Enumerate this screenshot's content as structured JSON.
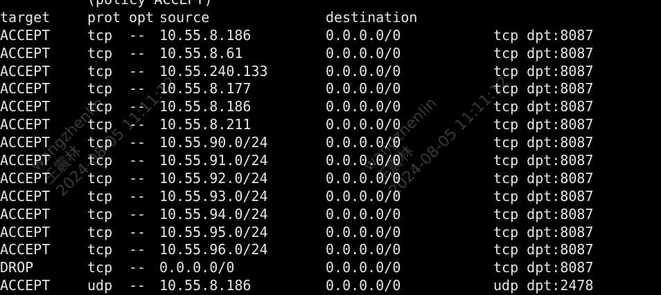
{
  "partial_top_text": "(policy ACCEPT)",
  "headers": {
    "target": "target",
    "prot": "prot",
    "opt": "opt",
    "source": "source",
    "destination": "destination"
  },
  "rows": [
    {
      "target": "ACCEPT",
      "prot": "tcp",
      "opt": "--",
      "source": "10.55.8.186",
      "destination": "0.0.0.0/0",
      "extra": "tcp dpt:8087"
    },
    {
      "target": "ACCEPT",
      "prot": "tcp",
      "opt": "--",
      "source": "10.55.8.61",
      "destination": "0.0.0.0/0",
      "extra": "tcp dpt:8087"
    },
    {
      "target": "ACCEPT",
      "prot": "tcp",
      "opt": "--",
      "source": "10.55.240.133",
      "destination": "0.0.0.0/0",
      "extra": "tcp dpt:8087"
    },
    {
      "target": "ACCEPT",
      "prot": "tcp",
      "opt": "--",
      "source": "10.55.8.177",
      "destination": "0.0.0.0/0",
      "extra": "tcp dpt:8087"
    },
    {
      "target": "ACCEPT",
      "prot": "tcp",
      "opt": "--",
      "source": "10.55.8.186",
      "destination": "0.0.0.0/0",
      "extra": "tcp dpt:8087"
    },
    {
      "target": "ACCEPT",
      "prot": "tcp",
      "opt": "--",
      "source": "10.55.8.211",
      "destination": "0.0.0.0/0",
      "extra": "tcp dpt:8087"
    },
    {
      "target": "ACCEPT",
      "prot": "tcp",
      "opt": "--",
      "source": "10.55.90.0/24",
      "destination": "0.0.0.0/0",
      "extra": "tcp dpt:8087"
    },
    {
      "target": "ACCEPT",
      "prot": "tcp",
      "opt": "--",
      "source": "10.55.91.0/24",
      "destination": "0.0.0.0/0",
      "extra": "tcp dpt:8087"
    },
    {
      "target": "ACCEPT",
      "prot": "tcp",
      "opt": "--",
      "source": "10.55.92.0/24",
      "destination": "0.0.0.0/0",
      "extra": "tcp dpt:8087"
    },
    {
      "target": "ACCEPT",
      "prot": "tcp",
      "opt": "--",
      "source": "10.55.93.0/24",
      "destination": "0.0.0.0/0",
      "extra": "tcp dpt:8087"
    },
    {
      "target": "ACCEPT",
      "prot": "tcp",
      "opt": "--",
      "source": "10.55.94.0/24",
      "destination": "0.0.0.0/0",
      "extra": "tcp dpt:8087"
    },
    {
      "target": "ACCEPT",
      "prot": "tcp",
      "opt": "--",
      "source": "10.55.95.0/24",
      "destination": "0.0.0.0/0",
      "extra": "tcp dpt:8087"
    },
    {
      "target": "ACCEPT",
      "prot": "tcp",
      "opt": "--",
      "source": "10.55.96.0/24",
      "destination": "0.0.0.0/0",
      "extra": "tcp dpt:8087"
    },
    {
      "target": "DROP",
      "prot": "tcp",
      "opt": "--",
      "source": "0.0.0.0/0",
      "destination": "0.0.0.0/0",
      "extra": "tcp dpt:8087"
    },
    {
      "target": "ACCEPT",
      "prot": "udp",
      "opt": "--",
      "source": "10.55.8.186",
      "destination": "0.0.0.0/0",
      "extra": "udp dpt:2478"
    }
  ],
  "watermark": {
    "line1": "wangzhenlin",
    "line2": "王震林",
    "line3": "2024-08-05 11:11:12"
  }
}
